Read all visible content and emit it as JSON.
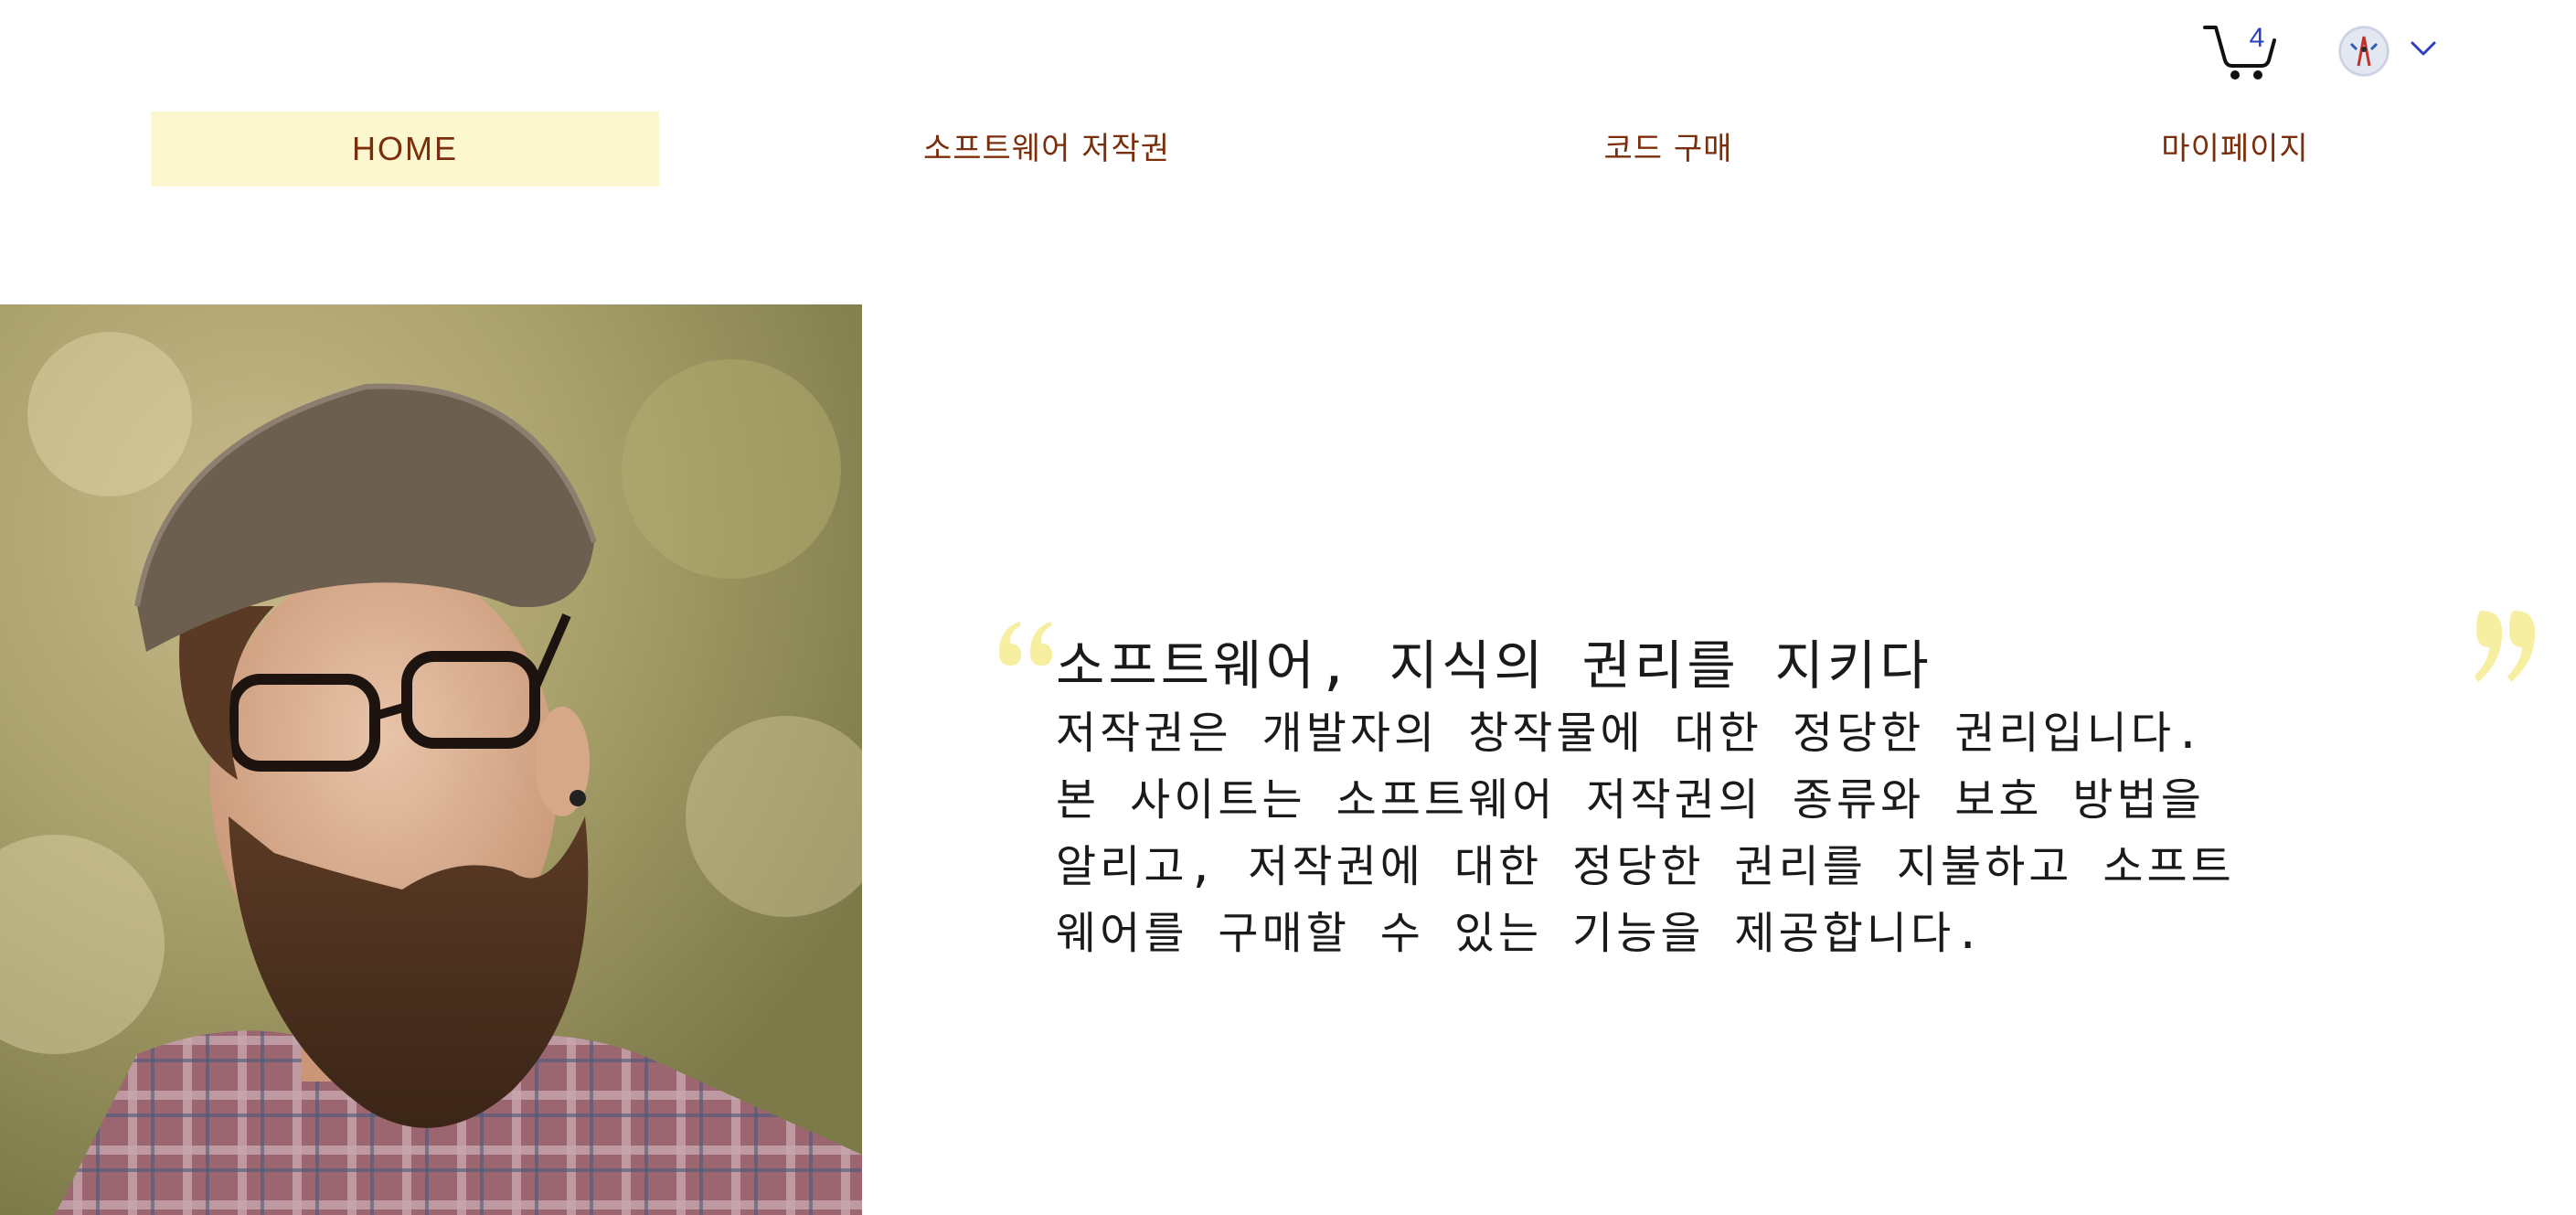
{
  "header": {
    "cart": {
      "icon": "cart-icon",
      "count": "4"
    },
    "account": {
      "avatar": "avatar-image",
      "menu_icon": "chevron-down-icon"
    }
  },
  "nav": {
    "items": [
      {
        "label": "HOME",
        "active": true
      },
      {
        "label": "소프트웨어 저작권"
      },
      {
        "label": "코드 구매"
      },
      {
        "label": "마이페이지"
      }
    ]
  },
  "hero": {
    "image": "man-with-beard-portrait",
    "quote": {
      "title": "소프트웨어, 지식의 권리를 지키다",
      "lines": [
        "저작권은 개발자의 창작물에 대한 정당한 권리입니다.",
        "본 사이트는 소프트웨어 저작권의 종류와 보호 방법을",
        "알리고, 저작권에 대한 정당한 권리를 지불하고 소프트",
        "웨어를 구매할 수 있는 기능을 제공합니다."
      ],
      "accent_color": "#f6eea0"
    }
  },
  "colors": {
    "nav_text": "#7a2e0b",
    "nav_active_bg": "#fcf7cf",
    "cart_badge": "#2c3ec4"
  }
}
